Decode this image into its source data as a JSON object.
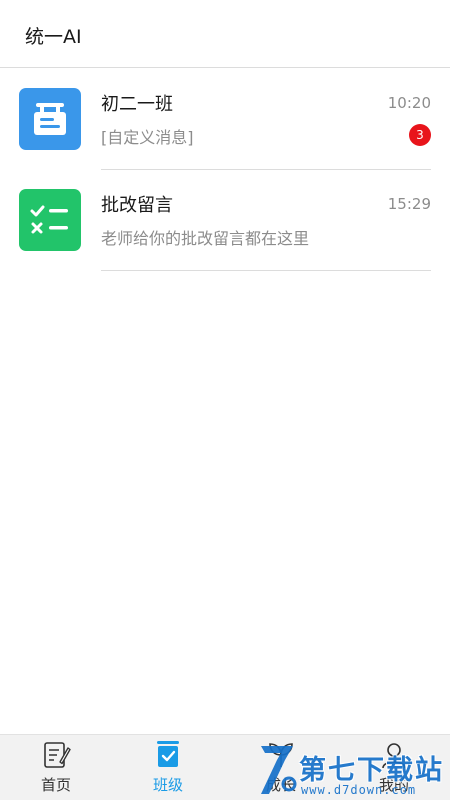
{
  "header": {
    "title": "统一AI"
  },
  "conversations": [
    {
      "name": "初二一班",
      "time": "10:20",
      "preview": "[自定义消息]",
      "unread": "3",
      "icon": "class-board-icon",
      "color": "#3a97ea"
    },
    {
      "name": "批改留言",
      "time": "15:29",
      "preview": "老师给你的批改留言都在这里",
      "icon": "correction-checklist-icon",
      "color": "#22c46a"
    }
  ],
  "tabbar": {
    "tabs": [
      {
        "label": "首页",
        "icon": "homework-note-icon",
        "active": false
      },
      {
        "label": "班级",
        "icon": "class-check-icon",
        "active": true
      },
      {
        "label": "成长",
        "icon": "sprout-icon",
        "active": false
      },
      {
        "label": "我的",
        "icon": "user-icon",
        "active": false
      }
    ]
  },
  "watermark": {
    "title": "第七下载站",
    "url": "www.d7down.com"
  },
  "colors": {
    "accent": "#1a9be6",
    "badge": "#e8141b",
    "class_icon_bg": "#3a97ea",
    "comment_icon_bg": "#22c46a"
  }
}
